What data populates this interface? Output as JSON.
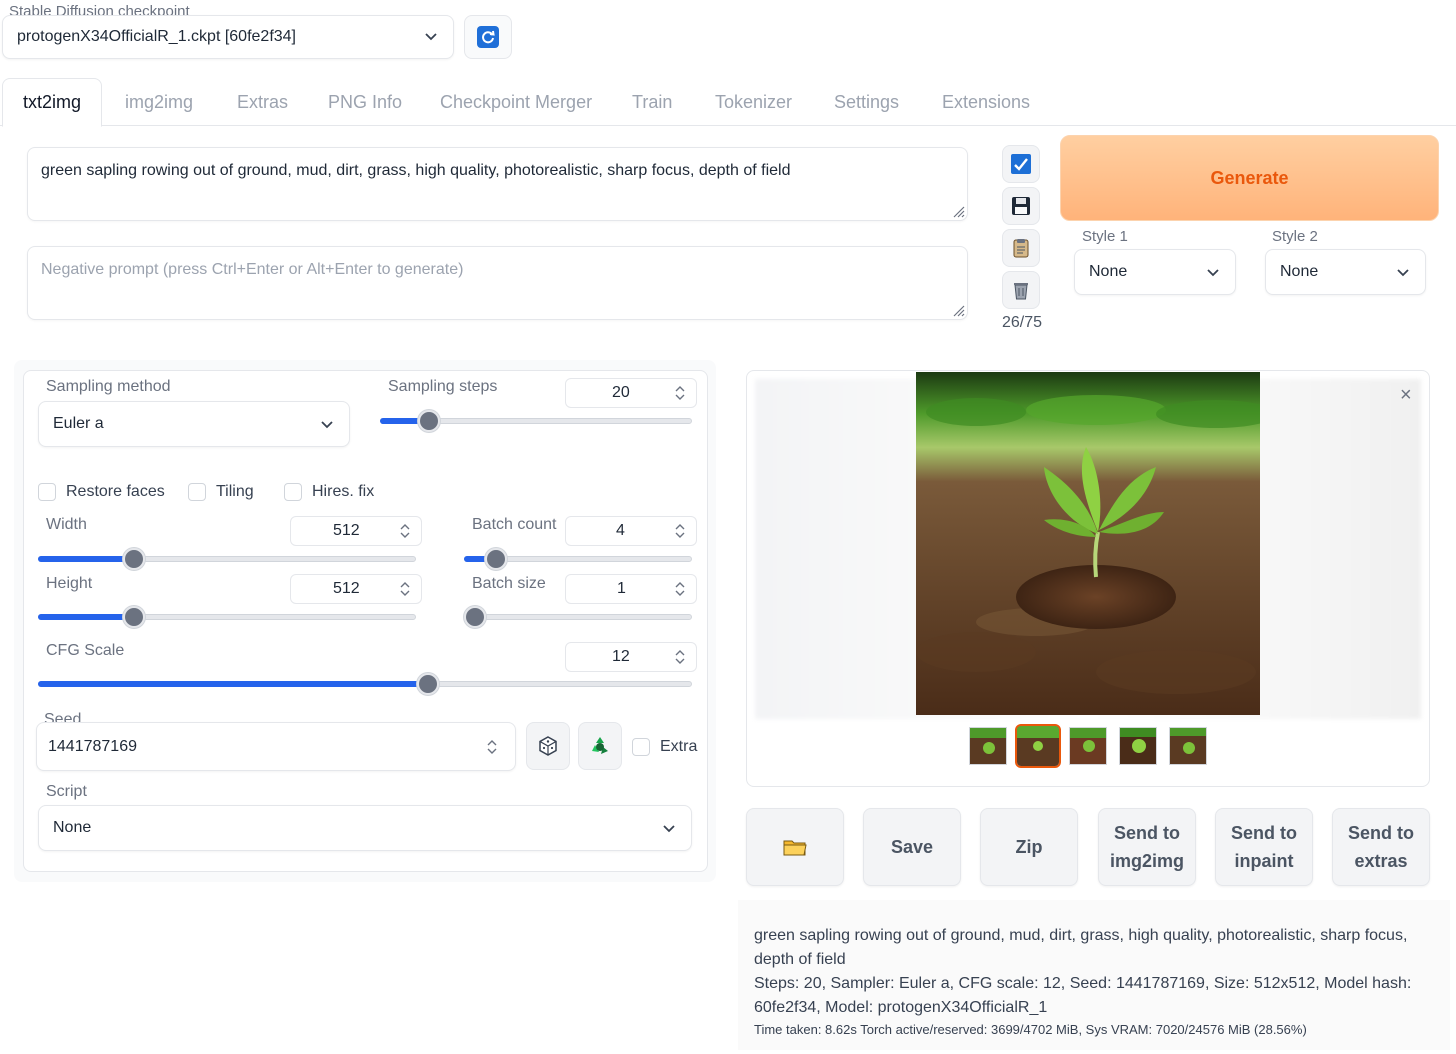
{
  "checkpoint": {
    "label": "Stable Diffusion checkpoint",
    "value": "protogenX34OfficialR_1.ckpt [60fe2f34]"
  },
  "tabs": [
    {
      "label": "txt2img",
      "active": true
    },
    {
      "label": "img2img"
    },
    {
      "label": "Extras"
    },
    {
      "label": "PNG Info"
    },
    {
      "label": "Checkpoint Merger"
    },
    {
      "label": "Train"
    },
    {
      "label": "Tokenizer"
    },
    {
      "label": "Settings"
    },
    {
      "label": "Extensions"
    }
  ],
  "prompt": {
    "value": "green sapling rowing out of ground, mud, dirt, grass, high quality, photorealistic, sharp focus, depth of field",
    "negative_placeholder": "Negative prompt (press Ctrl+Enter or Alt+Enter to generate)",
    "token_count": "26/75"
  },
  "generate": {
    "label": "Generate",
    "style1_label": "Style 1",
    "style1_value": "None",
    "style2_label": "Style 2",
    "style2_value": "None"
  },
  "settings": {
    "sampling_method_label": "Sampling method",
    "sampling_method_value": "Euler a",
    "sampling_steps_label": "Sampling steps",
    "sampling_steps_value": "20",
    "sampling_steps_level": 0.13,
    "restore_faces_label": "Restore faces",
    "tiling_label": "Tiling",
    "hires_label": "Hires. fix",
    "width_label": "Width",
    "width_value": "512",
    "width_level": 0.24,
    "height_label": "Height",
    "height_value": "512",
    "height_level": 0.24,
    "batch_count_label": "Batch count",
    "batch_count_value": "4",
    "batch_count_level": 0.1,
    "batch_size_label": "Batch size",
    "batch_size_value": "1",
    "batch_size_level": 0.0,
    "cfg_label": "CFG Scale",
    "cfg_value": "12",
    "cfg_level": 0.6,
    "seed_label": "Seed",
    "seed_value": "1441787169",
    "extra_label": "Extra",
    "script_label": "Script",
    "script_value": "None"
  },
  "actions": {
    "save": "Save",
    "zip": "Zip",
    "send_img2img_line1": "Send to",
    "send_img2img_line2": "img2img",
    "send_inpaint_line1": "Send to",
    "send_inpaint_line2": "inpaint",
    "send_extras_line1": "Send to",
    "send_extras_line2": "extras"
  },
  "info": {
    "prompt_line": "green sapling rowing out of ground, mud, dirt, grass, high quality, photorealistic, sharp focus, depth of field",
    "params_line": "Steps: 20, Sampler: Euler a, CFG scale: 12, Seed: 1441787169, Size: 512x512, Model hash: 60fe2f34, Model: protogenX34OfficialR_1",
    "perf_line": "Time taken: 8.62s  Torch active/reserved: 3699/4702 MiB, Sys VRAM: 7020/24576 MiB (28.56%)"
  },
  "colors": {
    "accent_blue": "#2563eb",
    "generate_text": "#ea580c",
    "generate_bg": "#ffc08c"
  }
}
